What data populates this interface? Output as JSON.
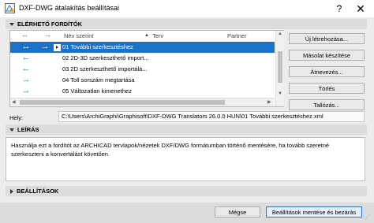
{
  "window": {
    "title": "DXF-DWG átalakítás beállításai",
    "help_glyph": "?",
    "close_glyph": "✕"
  },
  "translators": {
    "header": "ELÉRHETŐ FORDÍTÓK",
    "columns": {
      "name": "Név szerint",
      "status": "Terv",
      "partner": "Partner",
      "sort_glyph": "▲"
    },
    "rows": [
      {
        "direction": "↔",
        "name": "01 További szerkesztéshez",
        "selected": true,
        "dir_color": "#ffffff"
      },
      {
        "direction": "←",
        "name": "02 2D-3D szerkeszthető import...",
        "selected": false,
        "dir_color": "#1a73c8"
      },
      {
        "direction": "←",
        "name": "03 2D szerkeszthető importálá...",
        "selected": false,
        "dir_color": "#1a9c3a"
      },
      {
        "direction": "→",
        "name": "04 Toll sorszám megtartása",
        "selected": false,
        "dir_color": "#1a9c3a"
      },
      {
        "direction": "→",
        "name": "05 Változatlan kimenethez",
        "selected": false,
        "dir_color": "#1a9c3a"
      }
    ]
  },
  "side_buttons": {
    "new": "Új létrehozása...",
    "copy": "Másolat készítése",
    "rename": "Átnevezés...",
    "delete": "Törlés",
    "browse": "Tallózás..."
  },
  "location": {
    "label": "Hely:",
    "path": "C:\\Users\\ArchiGraphi\\Graphisoft\\DXF-DWG Translators 26.0.0 HUN\\01 További szerkesztéshez.xml"
  },
  "description": {
    "header": "LEÍRÁS",
    "text": "Használja ezt a fordítót az ARCHICAD tervlapok/nézetek DXF/DWG formátumban történő mentésére, ha tovább szeretné szerkeszteni a konvertálást követően."
  },
  "settings": {
    "header": "BEÁLLÍTÁSOK"
  },
  "footer": {
    "cancel": "Mégse",
    "save_close": "Beállítások mentése és bezárás"
  },
  "colors": {
    "accent": "#1a73c8",
    "green": "#1a9c3a"
  }
}
